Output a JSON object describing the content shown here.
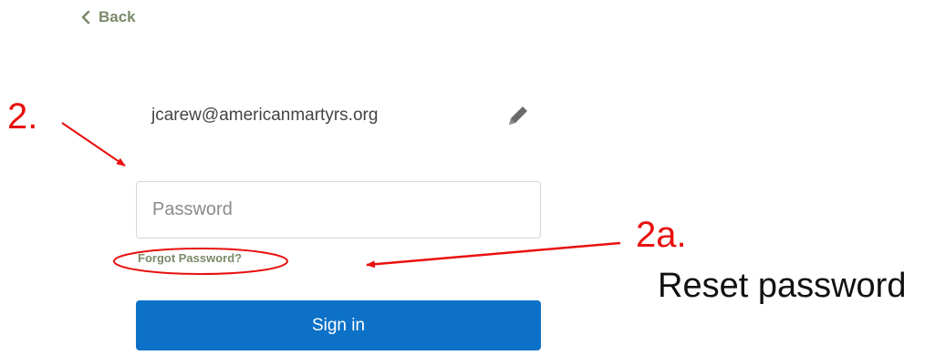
{
  "nav": {
    "back_label": "Back"
  },
  "account": {
    "email": "jcarew@americanmartyrs.org"
  },
  "form": {
    "password_placeholder": "Password",
    "forgot_label": "Forgot Password?",
    "signin_label": "Sign in"
  },
  "annotations": {
    "step_2": "2.",
    "step_2a": "2a.",
    "reset_caption": "Reset password",
    "color": "#e8100f"
  },
  "colors": {
    "primary_button": "#0c71c7",
    "link": "#7a8a6a"
  },
  "icons": {
    "back": "chevron-left-icon",
    "edit": "pencil-icon"
  }
}
